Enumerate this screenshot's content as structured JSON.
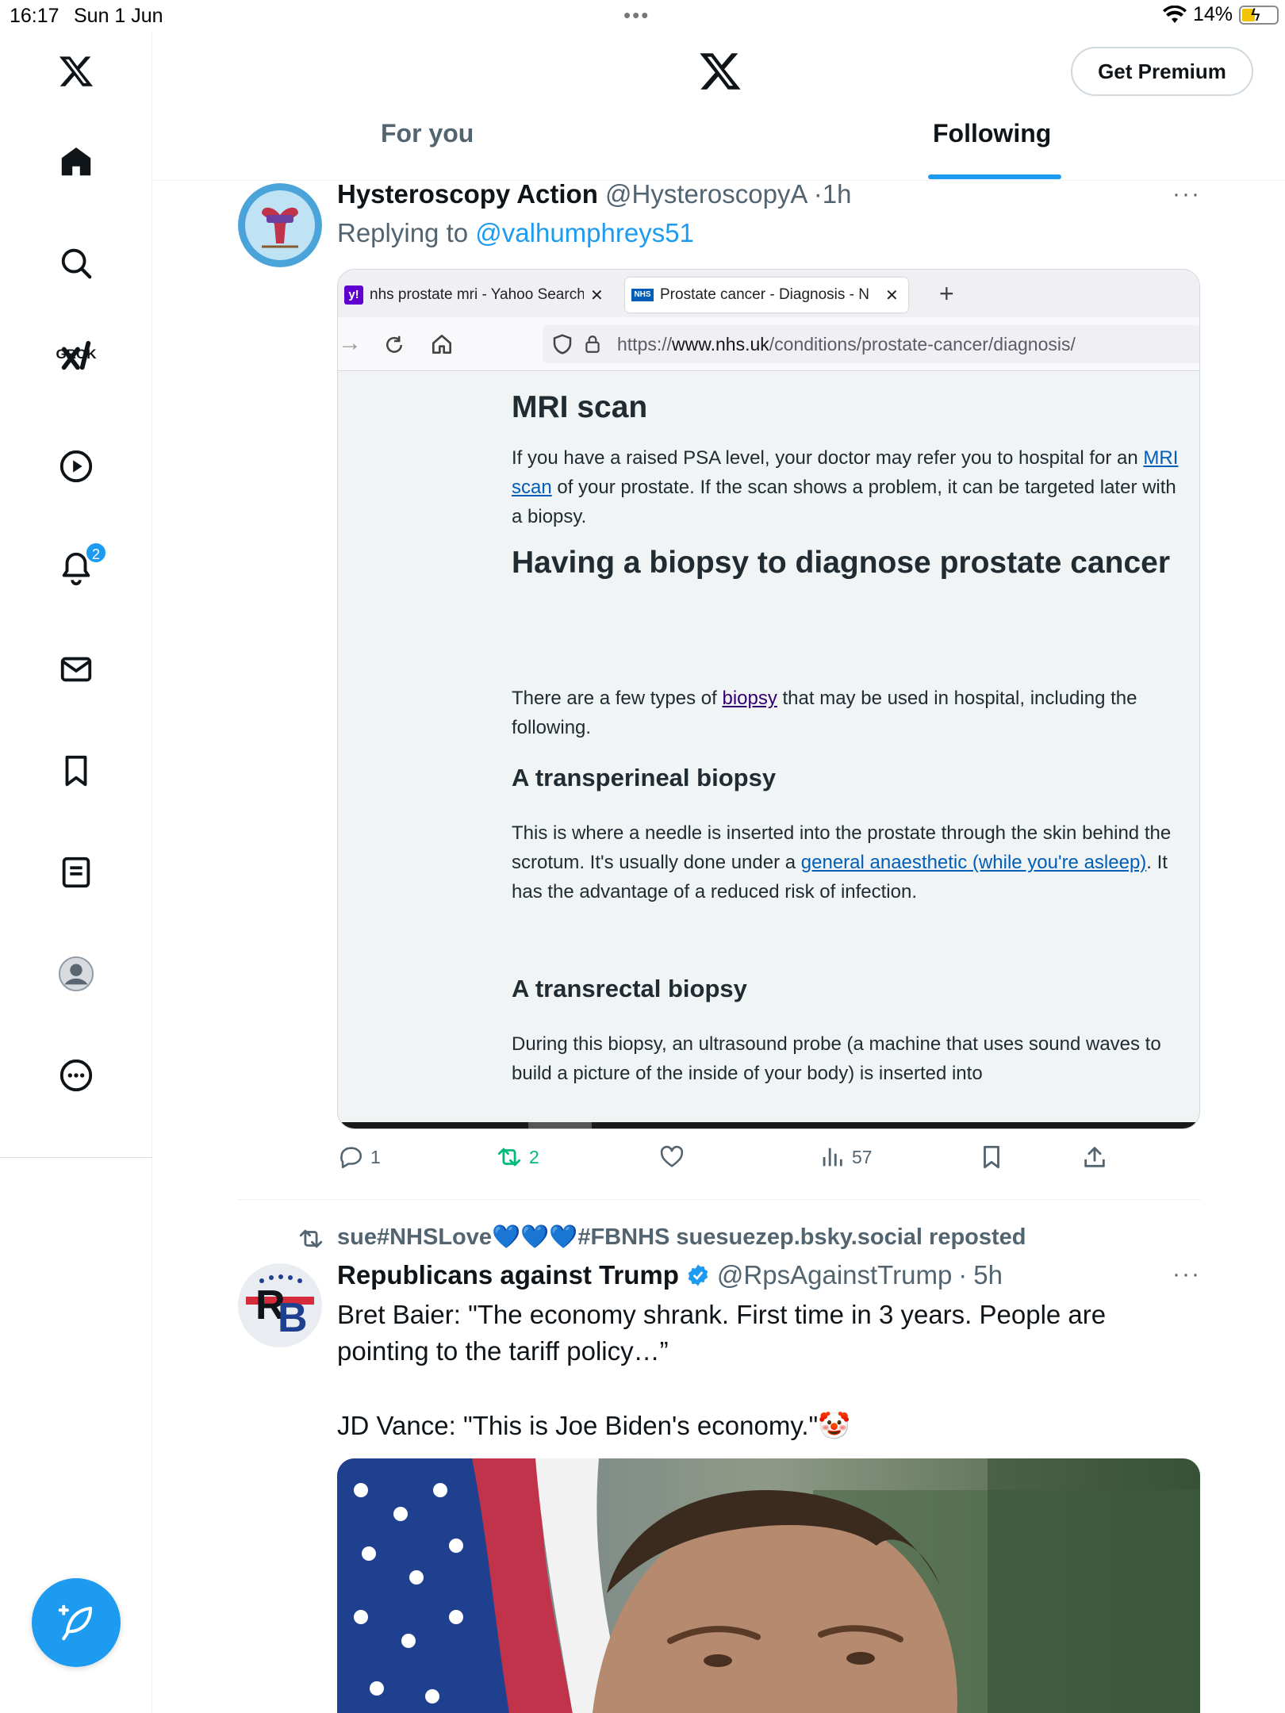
{
  "status_bar": {
    "time": "16:17",
    "date": "Sun 1 Jun",
    "battery": "14%"
  },
  "sidebar": {
    "grok_label": "GROK",
    "notification_count": "2"
  },
  "header": {
    "premium_label": "Get Premium",
    "tabs": [
      {
        "label": "For you",
        "active": false
      },
      {
        "label": "Following",
        "active": true
      }
    ]
  },
  "post1": {
    "display_name": "Hysteroscopy Action",
    "handle": "@HysteroscopyA",
    "time": "1h",
    "replying_prefix": "Replying to",
    "replying_to": "@valhumphreys51",
    "embedded": {
      "tab1": "nhs prostate mri - Yahoo Search",
      "tab2": "Prostate cancer - Diagnosis - N",
      "url_prefix": "https://",
      "url_domain": "www.nhs.uk",
      "url_path": "/conditions/prostate-cancer/diagnosis/",
      "h_mri": "MRI scan",
      "p_mri_1": "If you have a raised PSA level, your doctor may refer you to hospital for an ",
      "p_mri_link": "MRI scan",
      "p_mri_2": " of your prostate. If the scan shows a problem, it can be targeted later with a biopsy.",
      "h_biopsy": "Having a biopsy to diagnose prostate cancer",
      "p_biopsy_1": "There are a few types of ",
      "p_biopsy_link": "biopsy",
      "p_biopsy_2": " that may be used in hospital, including the following.",
      "h_transperineal": "A transperineal biopsy",
      "p_transperineal_1": "This is where a needle is inserted into the prostate through the skin behind the scrotum. It's usually done under a ",
      "p_transperineal_link": "general anaesthetic (while you're asleep)",
      "p_transperineal_2": ". It has the advantage of a reduced risk of infection.",
      "h_transrectal": "A transrectal biopsy",
      "p_transrectal": "During this biopsy, an ultrasound probe (a machine that uses sound waves to build a picture of the inside of your body) is inserted into"
    },
    "actions": {
      "replies": "1",
      "reposts": "2",
      "views": "57"
    }
  },
  "post2": {
    "repost_label": "sue#NHSLove💙💙💙#FBNHS suesuezep.bsky.social reposted",
    "display_name": "Republicans against Trump",
    "handle": "@RpsAgainstTrump",
    "time": "5h",
    "text_line1": "Bret Baier: \"The economy shrank. First time in 3 years. People are pointing to the tariff policy…”",
    "text_line2": "JD Vance: \"This is Joe Biden's economy.\"🤡"
  },
  "colors": {
    "accent": "#1d9bf0",
    "repost_green": "#00ba7c",
    "muted": "#536471",
    "nhs_link": "#005eb8"
  }
}
